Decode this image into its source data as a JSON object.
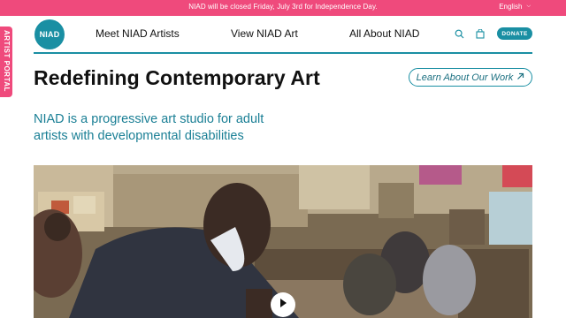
{
  "announcement": {
    "text": "NIAD will be closed Friday, July 3rd for Independence Day.",
    "language": "English"
  },
  "side_tab": {
    "label": "ARTIST PORTAL"
  },
  "header": {
    "logo_text": "NIAD",
    "nav": [
      {
        "label": "Meet NIAD Artists"
      },
      {
        "label": "View NIAD Art"
      },
      {
        "label": "All About NIAD"
      }
    ],
    "search_icon": "search-icon",
    "cart_icon": "bag-icon",
    "donate_label": "DONATE"
  },
  "main": {
    "title": "Redefining Contemporary Art",
    "cta_label": "Learn About Our Work",
    "cta_icon": "arrow-up-right-icon",
    "intro": "NIAD is a progressive art studio for adult artists with developmental disabilities"
  },
  "video": {
    "play_icon": "play-icon"
  },
  "colors": {
    "announcement_bg": "#ef4a7c",
    "brand_teal": "#1a8fa3",
    "intro_text": "#1a7f95"
  }
}
